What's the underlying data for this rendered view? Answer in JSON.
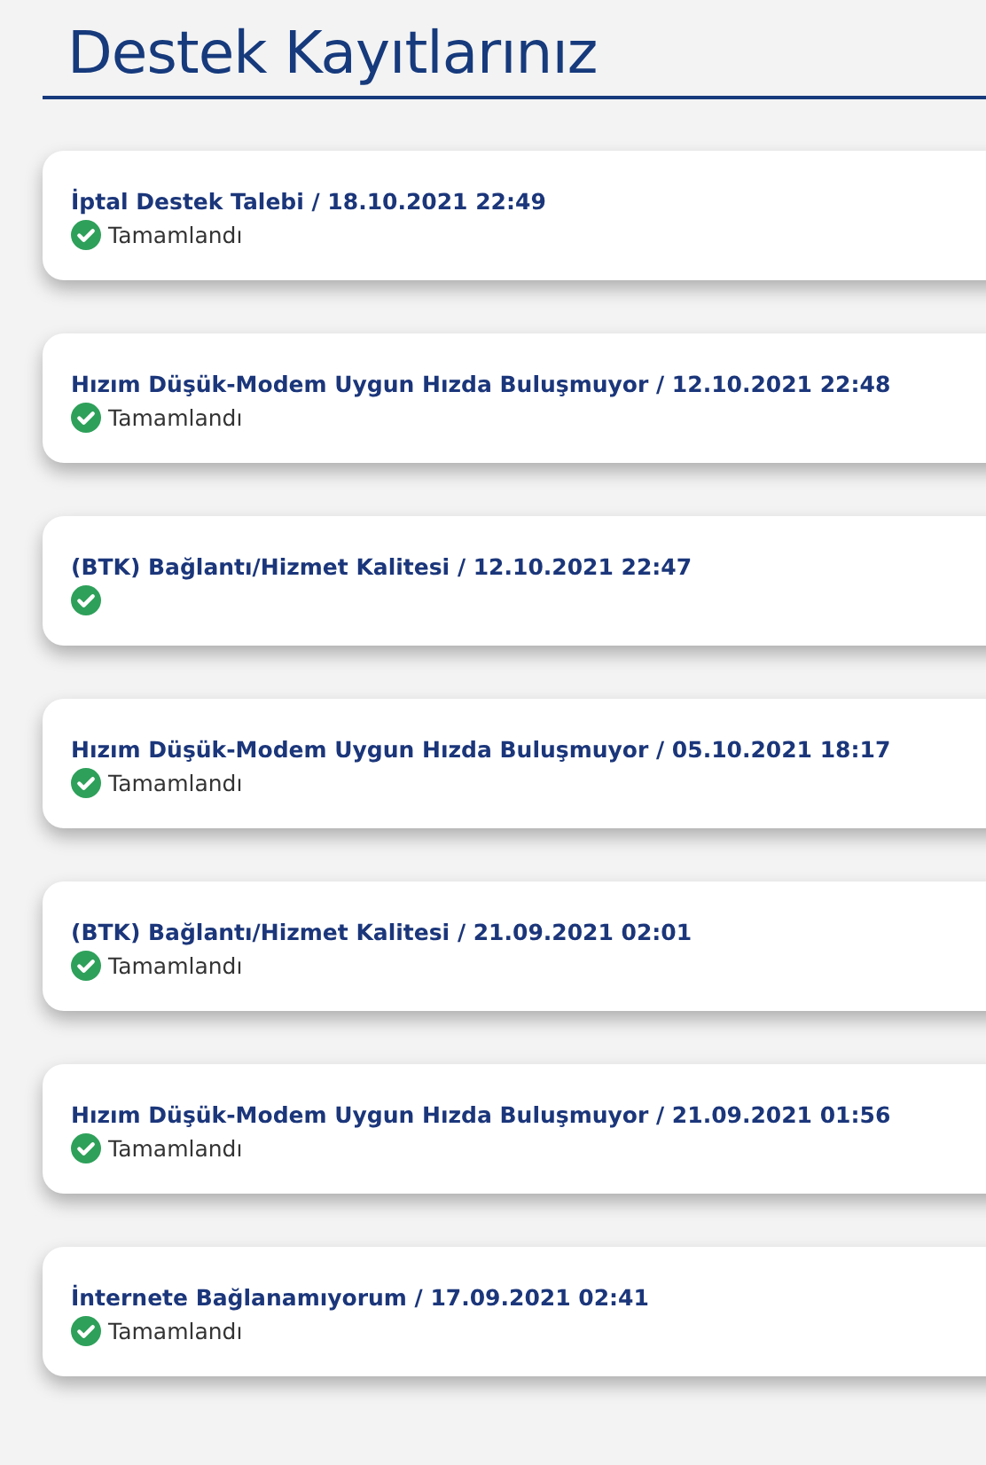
{
  "title": "Destek Kayıtlarınız",
  "tickets": [
    {
      "title": "İptal Destek Talebi / 18.10.2021 22:49",
      "completed": true,
      "status": "Tamamlandı"
    },
    {
      "title": "Hızım Düşük-Modem Uygun Hızda Buluşmuyor / 12.10.2021 22:48",
      "completed": true,
      "status": "Tamamlandı"
    },
    {
      "title": "(BTK) Bağlantı/Hizmet Kalitesi / 12.10.2021 22:47",
      "completed": true
    },
    {
      "title": "Hızım Düşük-Modem Uygun Hızda Buluşmuyor / 05.10.2021 18:17",
      "completed": true,
      "status": "Tamamlandı"
    },
    {
      "title": "(BTK) Bağlantı/Hizmet Kalitesi / 21.09.2021 02:01",
      "completed": true,
      "status": "Tamamlandı"
    },
    {
      "title": "Hızım Düşük-Modem Uygun Hızda Buluşmuyor / 21.09.2021 01:56",
      "completed": true,
      "status": "Tamamlandı"
    },
    {
      "title": "İnternete Bağlanamıyorum / 17.09.2021 02:41",
      "completed": true,
      "status": "Tamamlandı"
    }
  ]
}
